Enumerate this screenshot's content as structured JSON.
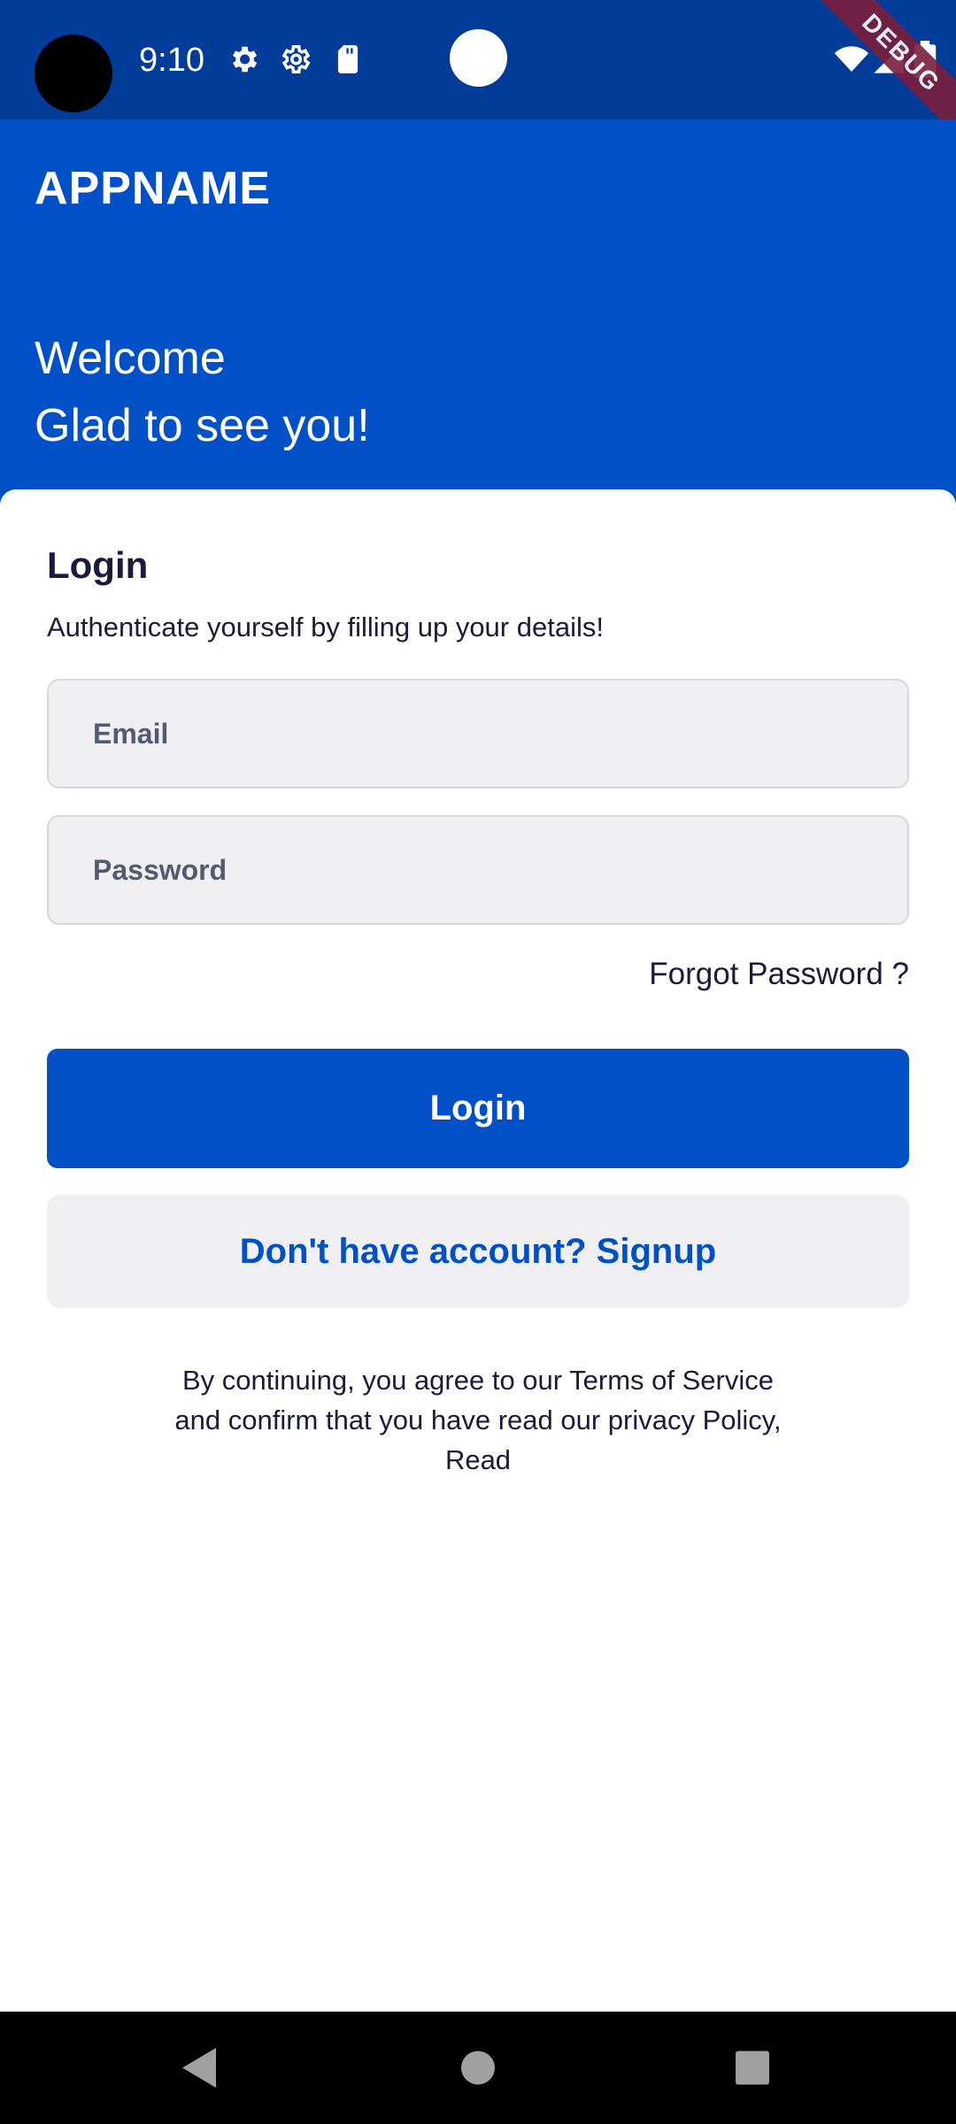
{
  "status_bar": {
    "time": "9:10",
    "icons": [
      "settings-icon",
      "settings-outline-icon",
      "sd-card-icon",
      "wifi-icon",
      "signal-icon",
      "battery-icon"
    ],
    "debug_label": "DEBUG"
  },
  "header": {
    "app_name": "APPNAME",
    "welcome_line1": "Welcome",
    "welcome_line2": "Glad to see you!"
  },
  "login": {
    "title": "Login",
    "subtitle": "Authenticate yourself by filling up your details!",
    "email_placeholder": "Email",
    "password_placeholder": "Password",
    "forgot_label": "Forgot Password ?",
    "login_button": "Login",
    "signup_button": "Don't have account? Signup",
    "terms_line1": "By continuing, you agree to our Terms of Service",
    "terms_line2": "and confirm that you have read our privacy Policy,",
    "terms_line3": "Read"
  },
  "nav_bar": {
    "buttons": [
      "back-icon",
      "home-icon",
      "recents-icon"
    ]
  },
  "colors": {
    "primary": "#0050c8",
    "status_bar": "#013c98",
    "text_dark": "#1b1a3a",
    "input_bg": "#f0f0f2"
  }
}
